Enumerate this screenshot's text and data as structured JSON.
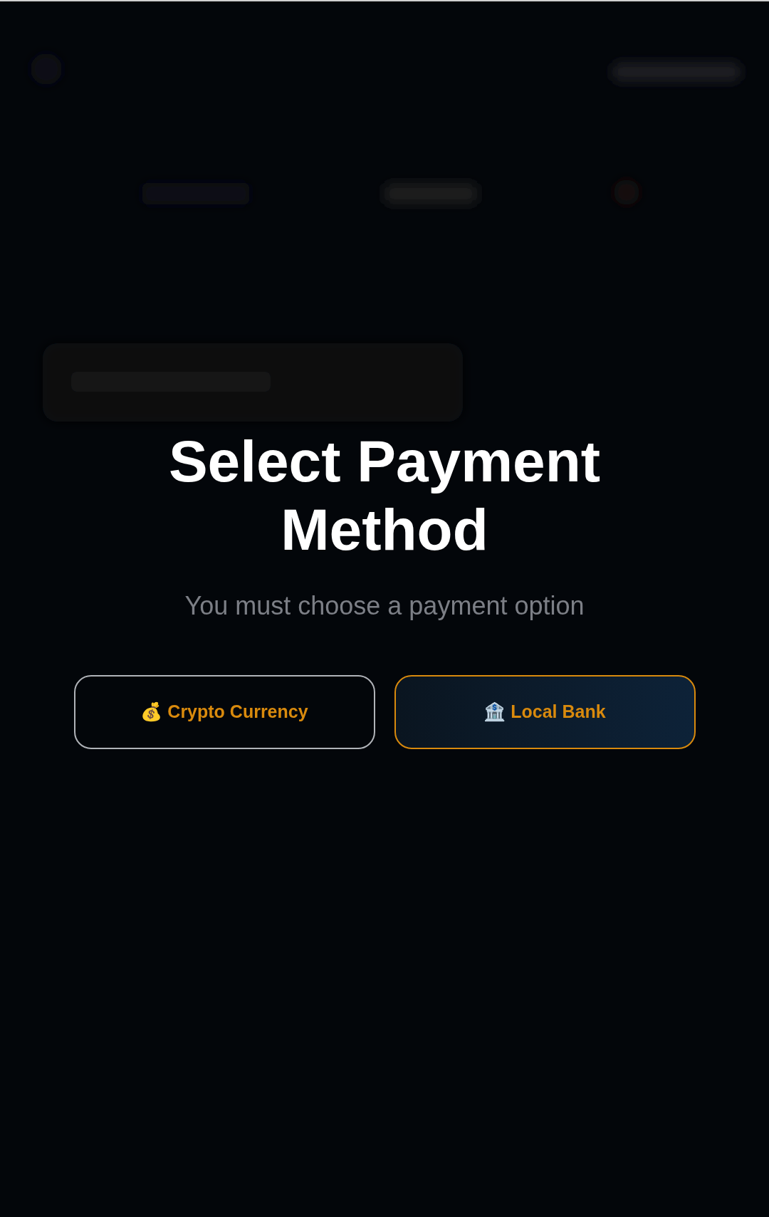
{
  "dialog": {
    "title": "Select Payment Method",
    "subtitle": "You must choose a payment option"
  },
  "options": [
    {
      "label": "💰 Crypto Currency",
      "selected": false
    },
    {
      "label": "🏦 Local Bank",
      "selected": true
    }
  ]
}
